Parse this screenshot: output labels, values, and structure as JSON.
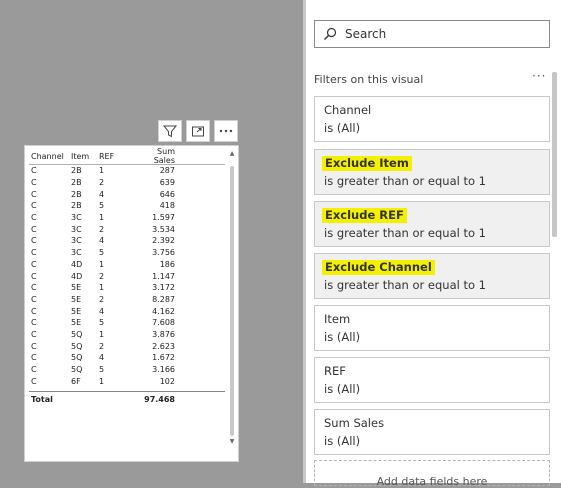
{
  "table": {
    "columns": [
      "Channel",
      "Item",
      "REF",
      "Sum Sales"
    ],
    "rows": [
      [
        "C",
        "2B",
        "1",
        "287"
      ],
      [
        "C",
        "2B",
        "2",
        "639"
      ],
      [
        "C",
        "2B",
        "4",
        "646"
      ],
      [
        "C",
        "2B",
        "5",
        "418"
      ],
      [
        "C",
        "3C",
        "1",
        "1.597"
      ],
      [
        "C",
        "3C",
        "2",
        "3.534"
      ],
      [
        "C",
        "3C",
        "4",
        "2.392"
      ],
      [
        "C",
        "3C",
        "5",
        "3.756"
      ],
      [
        "C",
        "4D",
        "1",
        "186"
      ],
      [
        "C",
        "4D",
        "2",
        "1.147"
      ],
      [
        "C",
        "5E",
        "1",
        "3.172"
      ],
      [
        "C",
        "5E",
        "2",
        "8.287"
      ],
      [
        "C",
        "5E",
        "4",
        "4.162"
      ],
      [
        "C",
        "5E",
        "5",
        "7.608"
      ],
      [
        "C",
        "5Q",
        "1",
        "3.876"
      ],
      [
        "C",
        "5Q",
        "2",
        "2.623"
      ],
      [
        "C",
        "5Q",
        "4",
        "1.672"
      ],
      [
        "C",
        "5Q",
        "5",
        "3.166"
      ],
      [
        "C",
        "6F",
        "1",
        "102"
      ]
    ],
    "total_label": "Total",
    "total_value": "97.468"
  },
  "pane": {
    "search_placeholder": "Search",
    "section_title": "Filters on this visual",
    "more": "···",
    "cards": [
      {
        "name": "Channel",
        "condition": "is (All)",
        "highlighted": false
      },
      {
        "name": "Exclude Item",
        "condition": "is greater than or equal to 1",
        "highlighted": true
      },
      {
        "name": "Exclude REF",
        "condition": "is greater than or equal to 1",
        "highlighted": true
      },
      {
        "name": "Exclude Channel",
        "condition": "is greater than or equal to 1",
        "highlighted": true
      },
      {
        "name": "Item",
        "condition": "is (All)",
        "highlighted": false
      },
      {
        "name": "REF",
        "condition": "is (All)",
        "highlighted": false
      },
      {
        "name": "Sum Sales",
        "condition": "is (All)",
        "highlighted": false
      }
    ],
    "add_fields": "Add data fields here"
  },
  "icons": {
    "filter": "filter-icon",
    "focus": "focus-mode-icon",
    "more": "more-options-icon",
    "search": "search-icon"
  },
  "colors": {
    "highlight": "#f5f000",
    "canvas_bg": "#9a9a9a",
    "card_grey": "#f0f0f0"
  }
}
